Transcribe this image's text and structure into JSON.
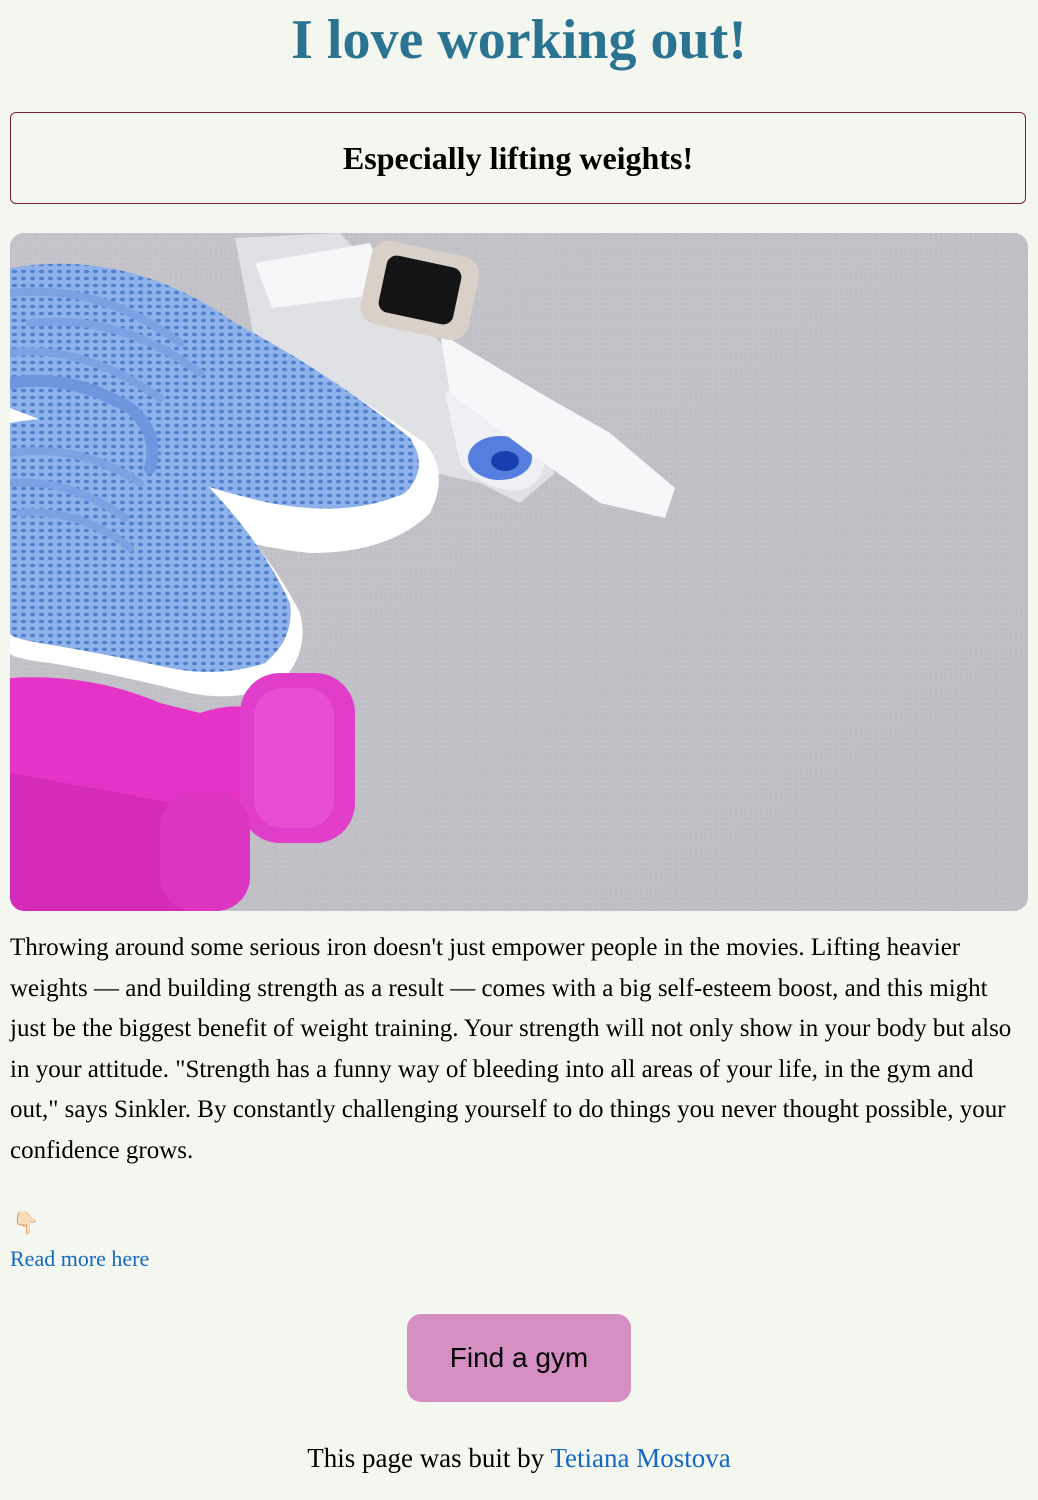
{
  "header": {
    "title": "I love working out!",
    "subtitle": "Especially lifting weights!"
  },
  "hero_image": {
    "alt": "Blue sneakers, pink dumbbells, water bottle and smart watch on a gray mat"
  },
  "article": {
    "paragraph": "Throwing around some serious iron doesn't just empower people in the movies. Lifting heavier weights — and building strength as a result — comes with a big self-esteem boost, and this might just be the biggest benefit of weight training. Your strength will not only show in your body but also in your attitude. \"Strength has a funny way of bleeding into all areas of your life, in the gym and out,\" says Sinkler. By constantly challenging yourself to do things you never thought possible, your confidence grows.",
    "pointer_emoji": "👇🏻",
    "read_more_label": "Read more here"
  },
  "cta": {
    "button_label": "Find a gym"
  },
  "footer": {
    "prefix": "This page was buit by",
    "author": "Tetiana Mostova"
  },
  "colors": {
    "background": "#f4f7ef",
    "title": "#2b7491",
    "subtitle_border": "#7e1f45",
    "link": "#1367c4",
    "button": "#d68fc3"
  }
}
